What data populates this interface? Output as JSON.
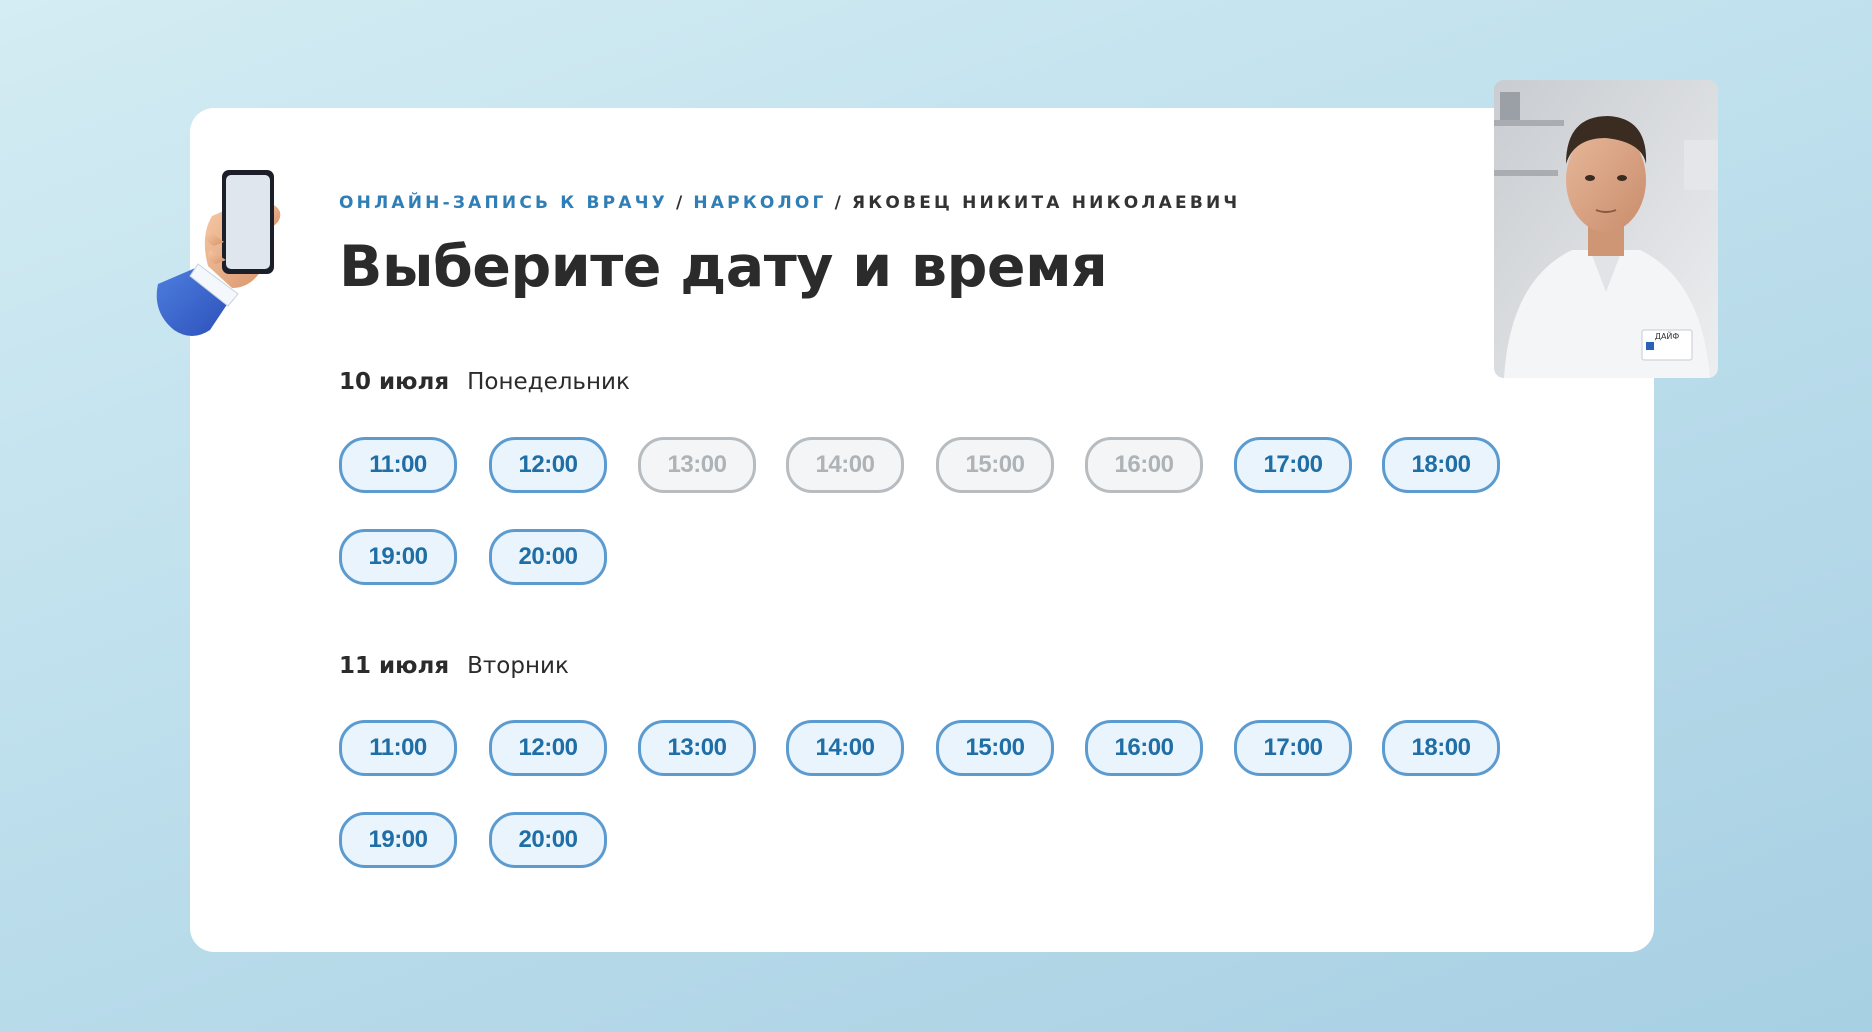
{
  "breadcrumb": {
    "items": [
      "ОНЛАЙН-ЗАПИСЬ К ВРАЧУ",
      "НАРКОЛОГ",
      "ЯКОВЕЦ НИКИТА НИКОЛАЕВИЧ"
    ],
    "separator": "/"
  },
  "title": "Выберите дату и время",
  "days": [
    {
      "date": "10 июля",
      "weekday": "Понедельник",
      "slots": [
        {
          "time": "11:00",
          "available": true
        },
        {
          "time": "12:00",
          "available": true
        },
        {
          "time": "13:00",
          "available": false
        },
        {
          "time": "14:00",
          "available": false
        },
        {
          "time": "15:00",
          "available": false
        },
        {
          "time": "16:00",
          "available": false
        },
        {
          "time": "17:00",
          "available": true
        },
        {
          "time": "18:00",
          "available": true
        },
        {
          "time": "19:00",
          "available": true
        },
        {
          "time": "20:00",
          "available": true
        }
      ]
    },
    {
      "date": "11 июля",
      "weekday": "Вторник",
      "slots": [
        {
          "time": "11:00",
          "available": true
        },
        {
          "time": "12:00",
          "available": true
        },
        {
          "time": "13:00",
          "available": true
        },
        {
          "time": "14:00",
          "available": true
        },
        {
          "time": "15:00",
          "available": true
        },
        {
          "time": "16:00",
          "available": true
        },
        {
          "time": "17:00",
          "available": true
        },
        {
          "time": "18:00",
          "available": true
        },
        {
          "time": "19:00",
          "available": true
        },
        {
          "time": "20:00",
          "available": true
        }
      ]
    }
  ],
  "colors": {
    "accent": "#1f6ea6",
    "slot_border": "#5b9bd0",
    "slot_fill": "#e9f4fd",
    "disabled": "#adb3b7"
  },
  "icons": [
    "hand-holding-phone-icon"
  ],
  "doctor_video": {
    "badge_text": "ДАЙФ"
  }
}
